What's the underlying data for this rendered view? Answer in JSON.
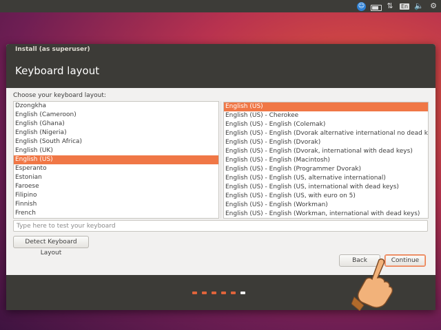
{
  "topbar": {
    "icons": [
      "accessibility-icon",
      "battery-icon",
      "network-icon",
      "language-icon",
      "volume-icon",
      "settings-icon"
    ],
    "language_label": "En"
  },
  "window": {
    "title": "Install (as superuser)",
    "page_title": "Keyboard layout"
  },
  "prompt": "Choose your keyboard layout:",
  "layouts": {
    "items": [
      "Dzongkha",
      "English (Cameroon)",
      "English (Ghana)",
      "English (Nigeria)",
      "English (South Africa)",
      "English (UK)",
      "English (US)",
      "Esperanto",
      "Estonian",
      "Faroese",
      "Filipino",
      "Finnish",
      "French"
    ],
    "selected": "English (US)"
  },
  "variants": {
    "items": [
      "English (US)",
      "English (US) - Cherokee",
      "English (US) - English (Colemak)",
      "English (US) - English (Dvorak alternative international no dead keys)",
      "English (US) - English (Dvorak)",
      "English (US) - English (Dvorak, international with dead keys)",
      "English (US) - English (Macintosh)",
      "English (US) - English (Programmer Dvorak)",
      "English (US) - English (US, alternative international)",
      "English (US) - English (US, international with dead keys)",
      "English (US) - English (US, with euro on 5)",
      "English (US) - English (Workman)",
      "English (US) - English (Workman, international with dead keys)"
    ],
    "selected": "English (US)"
  },
  "test_input": {
    "placeholder": "Type here to test your keyboard",
    "value": ""
  },
  "buttons": {
    "detect": "Detect Keyboard Layout",
    "back": "Back",
    "continue": "Continue"
  },
  "progress": {
    "total_steps": 6,
    "current_step": 6
  },
  "colors": {
    "accent": "#f07746",
    "titlebar": "#3c3b37",
    "topbar": "#3d3c38"
  }
}
